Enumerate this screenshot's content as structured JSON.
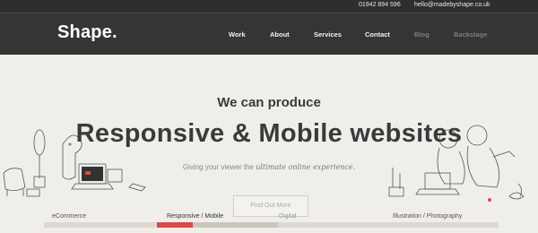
{
  "topbar": {
    "phone": "01942 894 596",
    "email": "hello@madebyshape.co.uk"
  },
  "header": {
    "logo": "Shape.",
    "nav": [
      {
        "label": "Work",
        "active": true
      },
      {
        "label": "About",
        "active": true
      },
      {
        "label": "Services",
        "active": true
      },
      {
        "label": "Contact",
        "active": true
      },
      {
        "label": "Blog",
        "active": false
      },
      {
        "label": "Backstage",
        "active": false
      }
    ]
  },
  "hero": {
    "pre_heading": "We can produce",
    "heading": "Responsive & Mobile websites",
    "tagline_plain": "Giving your viewer the",
    "tagline_italic": "ultimate online experience.",
    "cta": "Find Out More"
  },
  "tabs": [
    {
      "label": "eCommerce"
    },
    {
      "label": "Responsive / Mobile"
    },
    {
      "label": "Digital"
    },
    {
      "label": "Illustration / Photography"
    }
  ],
  "colors": {
    "accent": "#d94a46",
    "header": "#353535",
    "topbar": "#2e2e2e",
    "background": "#efeeea"
  }
}
